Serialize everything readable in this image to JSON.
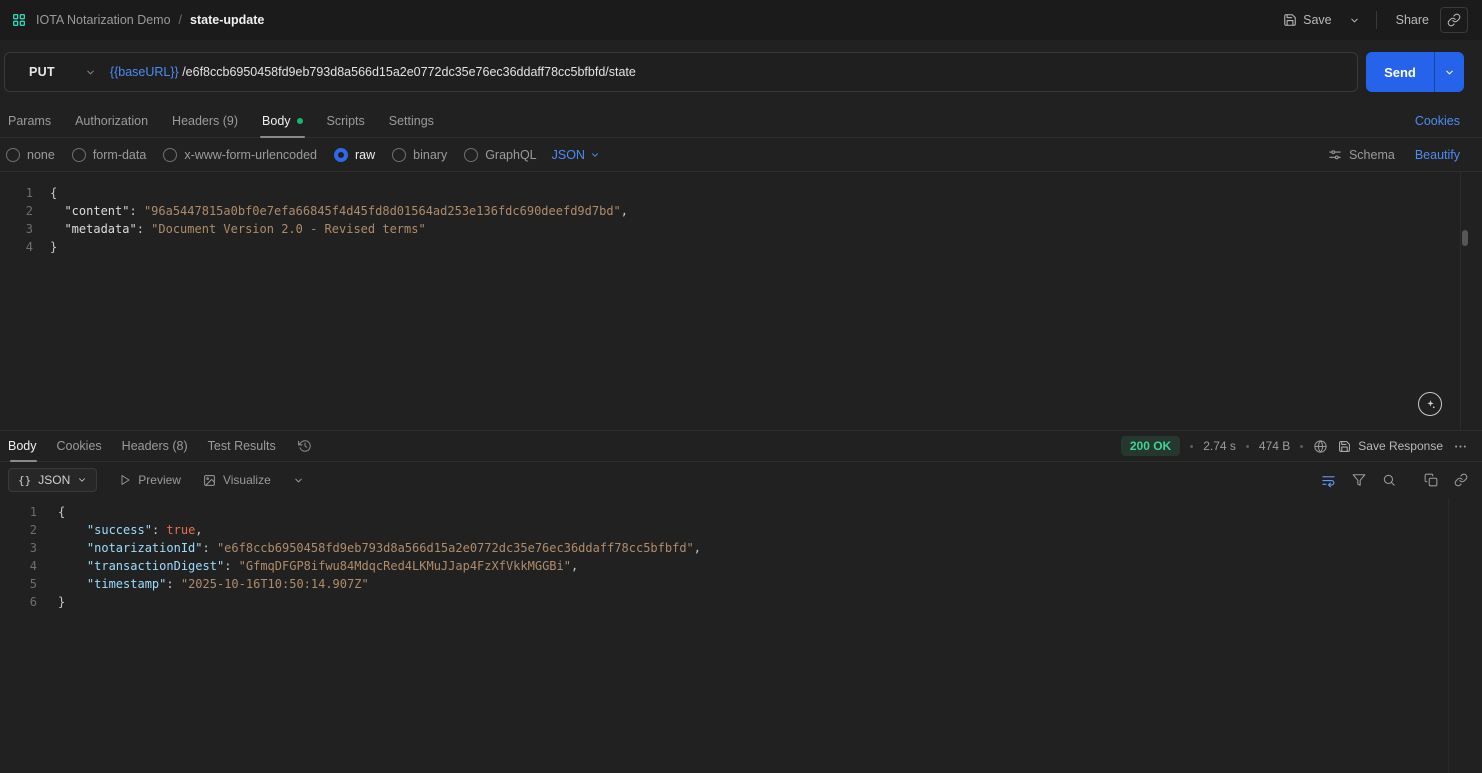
{
  "header": {
    "workspace_name": "IOTA Notarization Demo",
    "breadcrumb_separator": "/",
    "request_name": "state-update",
    "save_label": "Save",
    "share_label": "Share"
  },
  "request": {
    "method": "PUT",
    "url_variable": "{{baseURL}}",
    "url_path": "/e6f8ccb6950458fd9eb793d8a566d15a2e0772dc35e76ec36ddaff78cc5bfbfd/state",
    "send_label": "Send",
    "tabs": [
      {
        "label": "Params"
      },
      {
        "label": "Authorization"
      },
      {
        "label": "Headers (9)"
      },
      {
        "label": "Body",
        "active": true
      },
      {
        "label": "Scripts"
      },
      {
        "label": "Settings"
      }
    ],
    "cookies_label": "Cookies",
    "body_types": [
      {
        "label": "none"
      },
      {
        "label": "form-data"
      },
      {
        "label": "x-www-form-urlencoded"
      },
      {
        "label": "raw",
        "selected": true
      },
      {
        "label": "binary"
      },
      {
        "label": "GraphQL"
      }
    ],
    "language_selector": "JSON",
    "schema_label": "Schema",
    "beautify_label": "Beautify",
    "editor": {
      "lines": [
        [
          [
            "p",
            "{"
          ]
        ],
        [
          [
            "p",
            "  "
          ],
          [
            "k",
            "\"content\""
          ],
          [
            "p",
            ": "
          ],
          [
            "s",
            "\"96a5447815a0bf0e7efa66845f4d45fd8d01564ad253e136fdc690deefd9d7bd\""
          ],
          [
            "p",
            ","
          ]
        ],
        [
          [
            "p",
            "  "
          ],
          [
            "k",
            "\"metadata\""
          ],
          [
            "p",
            ": "
          ],
          [
            "s",
            "\"Document Version 2.0 - Revised terms\""
          ]
        ],
        [
          [
            "p",
            "}"
          ]
        ]
      ]
    }
  },
  "response": {
    "tabs": [
      {
        "label": "Body",
        "active": true
      },
      {
        "label": "Cookies"
      },
      {
        "label": "Headers (8)"
      },
      {
        "label": "Test Results"
      }
    ],
    "status": "200 OK",
    "time": "2.74 s",
    "size": "474 B",
    "save_response_label": "Save Response",
    "format_selector": "JSON",
    "preview_label": "Preview",
    "visualize_label": "Visualize",
    "editor": {
      "lines": [
        [
          [
            "p",
            "{"
          ]
        ],
        [
          [
            "p",
            "    "
          ],
          [
            "k",
            "\"success\""
          ],
          [
            "p",
            ": "
          ],
          [
            "b",
            "true"
          ],
          [
            "p",
            ","
          ]
        ],
        [
          [
            "p",
            "    "
          ],
          [
            "k",
            "\"notarizationId\""
          ],
          [
            "p",
            ": "
          ],
          [
            "s",
            "\"e6f8ccb6950458fd9eb793d8a566d15a2e0772dc35e76ec36ddaff78cc5bfbfd\""
          ],
          [
            "p",
            ","
          ]
        ],
        [
          [
            "p",
            "    "
          ],
          [
            "k",
            "\"transactionDigest\""
          ],
          [
            "p",
            ": "
          ],
          [
            "s",
            "\"GfmqDFGP8ifwu84MdqcRed4LKMuJJap4FzXfVkkMGGBi\""
          ],
          [
            "p",
            ","
          ]
        ],
        [
          [
            "p",
            "    "
          ],
          [
            "k",
            "\"timestamp\""
          ],
          [
            "p",
            ": "
          ],
          [
            "s",
            "\"2025-10-16T10:50:14.907Z\""
          ]
        ],
        [
          [
            "p",
            "}"
          ]
        ]
      ]
    }
  }
}
